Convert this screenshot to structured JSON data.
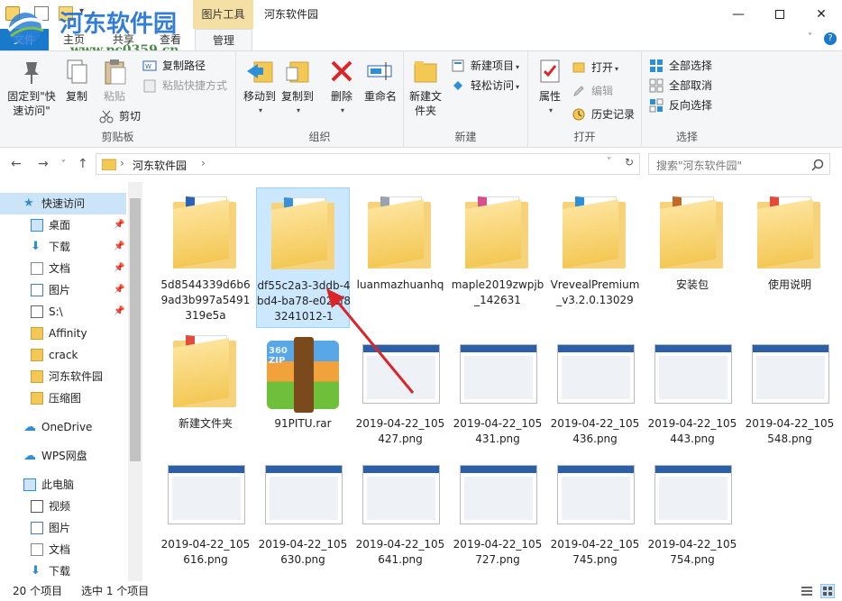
{
  "window": {
    "title": "河东软件园",
    "context_tab_title": "图片工具",
    "min_glyph": "—",
    "max_glyph": "",
    "close_glyph": "✕"
  },
  "watermark": {
    "title": "河东软件园",
    "url": "www.pc0359.cn"
  },
  "ribbon_tabs": {
    "file": "文件",
    "home": "主页",
    "share": "共享",
    "view": "查看",
    "manage": "管理",
    "expand_glyph": "˅",
    "help_glyph": "?"
  },
  "ribbon": {
    "clipboard": {
      "pin_quick_access": "固定到\"快速访问\"",
      "copy": "复制",
      "paste": "粘贴",
      "copy_path": "复制路径",
      "paste_shortcut": "粘贴快捷方式",
      "cut": "剪切",
      "group_label": "剪贴板"
    },
    "organize": {
      "move_to": "移动到",
      "copy_to": "复制到",
      "delete": "删除",
      "rename": "重命名",
      "group_label": "组织"
    },
    "new": {
      "new_folder": "新建文件夹",
      "new_item": "新建项目",
      "easy_access": "轻松访问",
      "group_label": "新建"
    },
    "open": {
      "properties": "属性",
      "open": "打开",
      "edit": "编辑",
      "history": "历史记录",
      "group_label": "打开"
    },
    "select": {
      "select_all": "全部选择",
      "select_none": "全部取消",
      "invert_selection": "反向选择",
      "group_label": "选择"
    }
  },
  "addressbar": {
    "back": "←",
    "forward": "→",
    "recent": "˅",
    "up": "↑",
    "path_separator": "›",
    "path": "河东软件园",
    "path_dropdown": "˅",
    "refresh": "↻",
    "search_placeholder": "搜索\"河东软件园\""
  },
  "navpane": {
    "items": [
      {
        "label": "快速访问",
        "pinned": false
      },
      {
        "label": "桌面",
        "pinned": true
      },
      {
        "label": "下载",
        "pinned": true
      },
      {
        "label": "文档",
        "pinned": true
      },
      {
        "label": "图片",
        "pinned": true
      },
      {
        "label": "S:\\",
        "pinned": true
      },
      {
        "label": "Affinity",
        "pinned": false
      },
      {
        "label": "crack",
        "pinned": false
      },
      {
        "label": "河东软件园",
        "pinned": false
      },
      {
        "label": "压缩图",
        "pinned": false
      },
      {
        "label": "OneDrive",
        "pinned": false
      },
      {
        "label": "WPS网盘",
        "pinned": false
      },
      {
        "label": "此电脑",
        "pinned": false
      },
      {
        "label": "视频",
        "pinned": false
      },
      {
        "label": "图片",
        "pinned": false
      },
      {
        "label": "文档",
        "pinned": false
      },
      {
        "label": "下载",
        "pinned": false
      }
    ],
    "pin_glyph": "📌"
  },
  "files": [
    {
      "name": "5d8544339d6b69ad3b997a5491319e5a",
      "kind": "folder"
    },
    {
      "name": "df55c2a3-3ddb-4bd4-ba78-e022f83241012-1",
      "kind": "folder",
      "selected": true
    },
    {
      "name": "luanmazhuanhq",
      "kind": "folder"
    },
    {
      "name": "maple2019zwpjb_142631",
      "kind": "folder"
    },
    {
      "name": "VrevealPremium_v3.2.0.13029",
      "kind": "folder"
    },
    {
      "name": "安装包",
      "kind": "folder"
    },
    {
      "name": "使用说明",
      "kind": "folder"
    },
    {
      "name": "新建文件夹",
      "kind": "folder"
    },
    {
      "name": "91PITU.rar",
      "kind": "archive",
      "badge": "360 ZIP"
    },
    {
      "name": "2019-04-22_105427.png",
      "kind": "image"
    },
    {
      "name": "2019-04-22_105431.png",
      "kind": "image"
    },
    {
      "name": "2019-04-22_105436.png",
      "kind": "image"
    },
    {
      "name": "2019-04-22_105443.png",
      "kind": "image"
    },
    {
      "name": "2019-04-22_105548.png",
      "kind": "image"
    },
    {
      "name": "2019-04-22_105616.png",
      "kind": "image"
    },
    {
      "name": "2019-04-22_105630.png",
      "kind": "image"
    },
    {
      "name": "2019-04-22_105641.png",
      "kind": "image"
    },
    {
      "name": "2019-04-22_105727.png",
      "kind": "image"
    },
    {
      "name": "2019-04-22_105745.png",
      "kind": "image"
    },
    {
      "name": "2019-04-22_105754.png",
      "kind": "image"
    }
  ],
  "status": {
    "item_count": "20 个项目",
    "selection": "选中 1 个项目"
  },
  "colors": {
    "accent": "#1979ca",
    "selection": "#cce8ff",
    "folder": "#f3c855",
    "context_tab": "#f4dfa5",
    "annotation_arrow": "#d9262b"
  }
}
